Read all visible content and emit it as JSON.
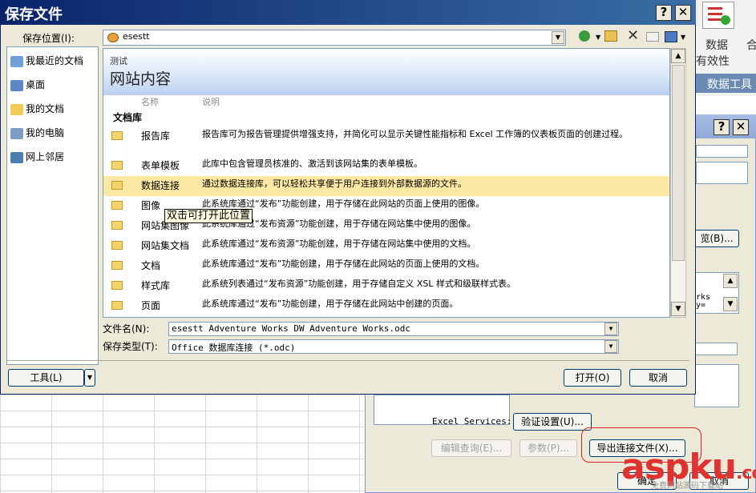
{
  "save_dialog": {
    "title": "保存文件",
    "save_in_label": "保存位置(I):",
    "save_in_value": "esestt",
    "places": [
      {
        "label": "我最近的文档",
        "icon": "recent-docs-icon"
      },
      {
        "label": "桌面",
        "icon": "desktop-icon"
      },
      {
        "label": "我的文档",
        "icon": "my-documents-icon"
      },
      {
        "label": "我的电脑",
        "icon": "my-computer-icon"
      },
      {
        "label": "网上邻居",
        "icon": "network-places-icon"
      }
    ],
    "site_small_title": "测试",
    "site_title": "网站内容",
    "col_name": "名称",
    "col_desc": "说明",
    "group_label": "文档库",
    "items": [
      {
        "name": "报告库",
        "desc": "报告库可为报告管理提供增强支持，并简化可以显示关键性能指标和 Excel 工作簿的仪表板页面的创建过程。"
      },
      {
        "name": "表单模板",
        "desc": "此库中包含管理员核准的、激活到该网站集的表单模板。"
      },
      {
        "name": "数据连接",
        "desc": "通过数据连接库，可以轻松共享便于用户连接到外部数据源的文件。"
      },
      {
        "name": "图像",
        "desc": "此系统库通过“发布”功能创建，用于存储在此网站的页面上使用的图像。"
      },
      {
        "name": "网站集图像",
        "desc": "此系统库通过“发布资源”功能创建，用于存储在网站集中使用的图像。"
      },
      {
        "name": "网站集文档",
        "desc": "此系统库通过“发布资源”功能创建，用于存储在网站集中使用的文档。"
      },
      {
        "name": "文档",
        "desc": "此系统库通过“发布”功能创建，用于存储在此网站的页面上使用的文档。"
      },
      {
        "name": "样式库",
        "desc": "此系统列表通过“发布资源”功能创建，用于存储自定义 XSL 样式和级联样式表。"
      },
      {
        "name": "页面",
        "desc": "此系统库通过“发布”功能创建，用于存储在此网站中创建的页面。"
      }
    ],
    "tooltip": "双击可打开此位置",
    "filename_label": "文件名(N):",
    "filename_value": "esestt Adventure Works DW Adventure Works.odc",
    "filetype_label": "保存类型(T):",
    "filetype_value": "Office 数据库连接 (*.odc)",
    "tools_label": "工具(L)",
    "open_label": "打开(O)",
    "cancel_label": "取消"
  },
  "excel_bg": {
    "ribbon_text1": "数据",
    "ribbon_text2": "有效性",
    "ribbon_text3": "合",
    "group_label": "数据工具"
  },
  "conn_dialog": {
    "browse_label": "览(B)...",
    "snippet1": "rks",
    "snippet2": "y=",
    "excel_services_label": "Excel Services:",
    "auth_settings_label": "验证设置(U)...",
    "edit_query_label": "编辑查询(E)...",
    "params_label": "参数(P)...",
    "export_label": "导出连接文件(X)...",
    "ok_label": "确定",
    "cancel_label": "取消"
  },
  "watermark": {
    "brand": "aspku",
    "sub": ".com",
    "slogan": "免费网站源码下载站"
  }
}
